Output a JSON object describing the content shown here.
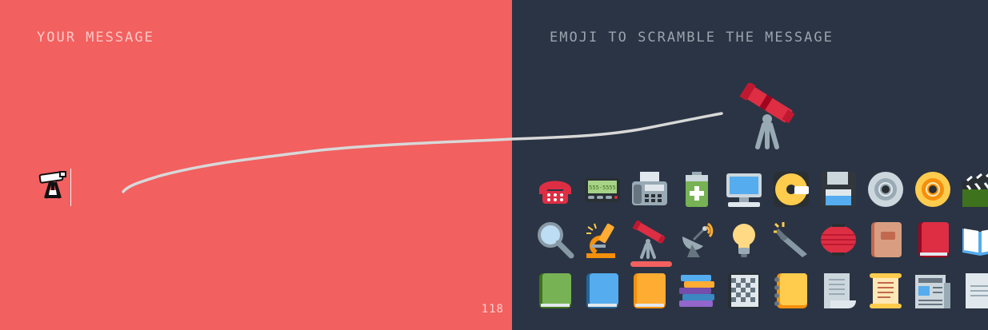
{
  "left_panel": {
    "heading": "YOUR MESSAGE",
    "message_emoji": "telescope-emoji",
    "char_count": "118",
    "bg_color": "#f26060"
  },
  "right_panel": {
    "heading": "EMOJI TO SCRAMBLE THE MESSAGE",
    "selected_emoji": "telescope",
    "bg_color": "#2b3444",
    "rows": [
      [
        "telephone",
        "pager",
        "fax-machine",
        "battery",
        "desktop-computer",
        "optical-disc",
        "floppy-disk",
        "cd",
        "dvd",
        "clapper-board"
      ],
      [
        "magnifying-glass",
        "microscope",
        "telescope",
        "satellite-antenna",
        "light-bulb",
        "flashlight",
        "red-lantern",
        "notebook-decorative",
        "closed-book",
        "open-book"
      ],
      [
        "green-book",
        "blue-book",
        "orange-book",
        "books",
        "notebook",
        "ledger",
        "page-curl",
        "scroll",
        "newspaper",
        "page-facing-up"
      ]
    ],
    "pager_text": "555-5555"
  }
}
